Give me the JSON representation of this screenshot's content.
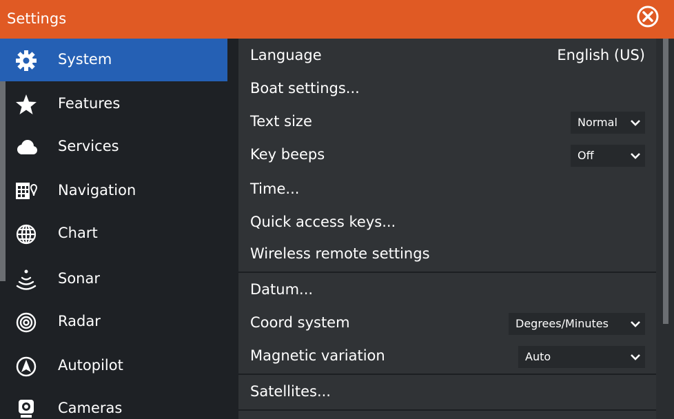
{
  "window": {
    "title": "Settings"
  },
  "sidebar": {
    "items": [
      {
        "label": "System",
        "icon": "gear-icon",
        "active": true
      },
      {
        "label": "Features",
        "icon": "star-icon"
      },
      {
        "label": "Services",
        "icon": "cloud-icon"
      },
      {
        "label": "Navigation",
        "icon": "navigation-icon"
      },
      {
        "label": "Chart",
        "icon": "globe-icon"
      },
      {
        "label": "Sonar",
        "icon": "sonar-icon"
      },
      {
        "label": "Radar",
        "icon": "radar-icon"
      },
      {
        "label": "Autopilot",
        "icon": "autopilot-icon"
      },
      {
        "label": "Cameras",
        "icon": "camera-icon"
      }
    ]
  },
  "settings": {
    "language": {
      "label": "Language",
      "value": "English (US)"
    },
    "boat_settings": {
      "label": "Boat settings..."
    },
    "text_size": {
      "label": "Text size",
      "value": "Normal"
    },
    "key_beeps": {
      "label": "Key beeps",
      "value": "Off"
    },
    "time": {
      "label": "Time..."
    },
    "quick_access_keys": {
      "label": "Quick access keys..."
    },
    "wireless_remote": {
      "label": "Wireless remote settings"
    },
    "datum": {
      "label": "Datum..."
    },
    "coord_system": {
      "label": "Coord system",
      "value": "Degrees/Minutes"
    },
    "magnetic_variation": {
      "label": "Magnetic variation",
      "value": "Auto"
    },
    "satellites": {
      "label": "Satellites..."
    }
  },
  "colors": {
    "titlebar": "#e05a24",
    "active_item": "#2560b4",
    "panel": "#303336",
    "sidebar": "#1e2125"
  }
}
